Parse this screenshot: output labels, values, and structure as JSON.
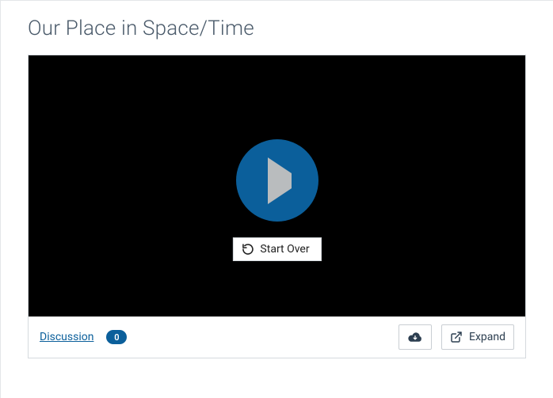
{
  "page": {
    "title": "Our Place in Space/Time"
  },
  "player": {
    "overlay_button_label": "Start Over"
  },
  "toolbar": {
    "discussion_label": "Discussion",
    "discussion_count": "0",
    "expand_label": "Expand"
  }
}
